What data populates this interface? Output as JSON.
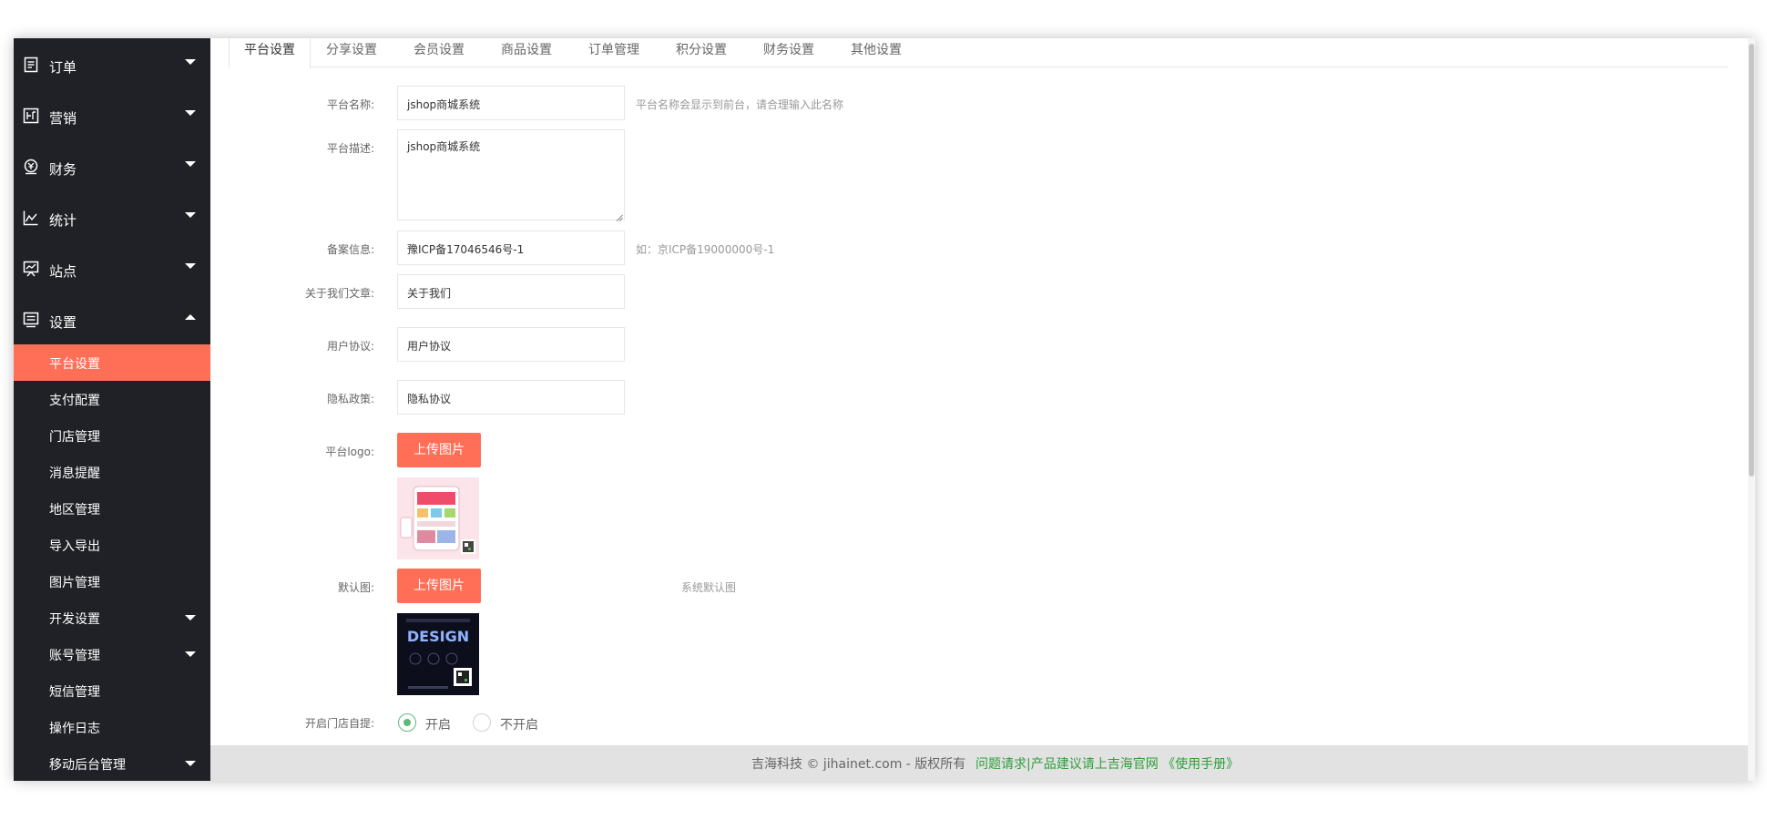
{
  "sidebar": {
    "items": [
      {
        "label": "订单",
        "icon": "order-icon"
      },
      {
        "label": "营销",
        "icon": "promotion-icon"
      },
      {
        "label": "财务",
        "icon": "finance-icon"
      },
      {
        "label": "统计",
        "icon": "chart-icon"
      },
      {
        "label": "站点",
        "icon": "site-icon"
      },
      {
        "label": "设置",
        "icon": "settings-icon"
      }
    ],
    "sub_items": [
      {
        "label": "平台设置",
        "active": true
      },
      {
        "label": "支付配置"
      },
      {
        "label": "门店管理"
      },
      {
        "label": "消息提醒"
      },
      {
        "label": "地区管理"
      },
      {
        "label": "导入导出"
      },
      {
        "label": "图片管理"
      },
      {
        "label": "开发设置"
      },
      {
        "label": "账号管理"
      },
      {
        "label": "短信管理"
      },
      {
        "label": "操作日志"
      },
      {
        "label": "移动后台管理"
      }
    ]
  },
  "tabs": [
    "平台设置",
    "分享设置",
    "会员设置",
    "商品设置",
    "订单管理",
    "积分设置",
    "财务设置",
    "其他设置"
  ],
  "form": {
    "platform_name": {
      "label": "平台名称:",
      "value": "jshop商城系统",
      "hint": "平台名称会显示到前台，请合理输入此名称"
    },
    "platform_desc": {
      "label": "平台描述:",
      "value": "jshop商城系统"
    },
    "icp": {
      "label": "备案信息:",
      "value": "豫ICP备17046546号-1",
      "hint": "如：京ICP备19000000号-1"
    },
    "about_us": {
      "label": "关于我们文章:",
      "value": "关于我们"
    },
    "user_agreement": {
      "label": "用户协议:",
      "value": "用户协议"
    },
    "privacy": {
      "label": "隐私政策:",
      "value": "隐私协议"
    },
    "logo": {
      "label": "平台logo:",
      "button": "上传图片"
    },
    "default_image": {
      "label": "默认图:",
      "button": "上传图片",
      "hint": "系统默认图",
      "thumb_text": "DESIGN"
    },
    "store_pickup": {
      "label": "开启门店自提:",
      "options": [
        "开启",
        "不开启"
      ],
      "selected": "开启"
    }
  },
  "footer": {
    "copyright": "吉海科技 © jihainet.com - 版权所有",
    "link": "问题请求|产品建议请上吉海官网 《使用手册》"
  },
  "colors": {
    "sidebar_bg": "#1f2127",
    "accent": "#ff6f58",
    "radio_checked": "#5fb878",
    "footer_link": "#2e9e3a"
  }
}
